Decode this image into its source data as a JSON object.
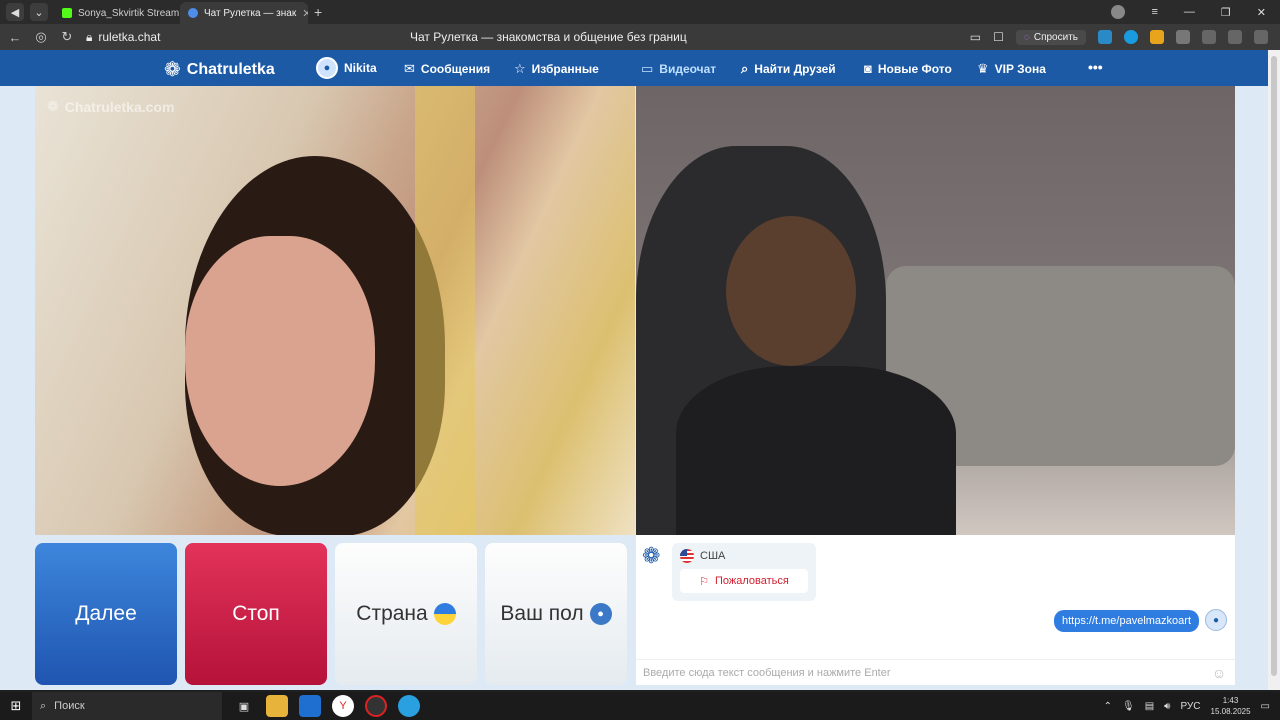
{
  "browser": {
    "tabs": [
      {
        "label": "Sonya_Skvirtik Stream - Ki"
      },
      {
        "label": "Чат Рулетка — знак"
      }
    ],
    "url": "ruletka.chat",
    "page_title": "Чат Рулетка — знакомства и общение без границ",
    "ask_label": "Спросить"
  },
  "site": {
    "logo": "Chatruletka",
    "nav": [
      {
        "label": "Nikita"
      },
      {
        "label": "Сообщения"
      },
      {
        "label": "Избранные"
      },
      {
        "label": "Видеочат"
      },
      {
        "label": "Найти Друзей"
      },
      {
        "label": "Новые Фото"
      },
      {
        "label": "VIP Зона"
      }
    ],
    "more": "•••"
  },
  "video": {
    "watermark": "Chatruletka.com"
  },
  "controls": {
    "next": "Далее",
    "stop": "Стоп",
    "country": "Страна",
    "gender": "Ваш пол"
  },
  "chat": {
    "partner_country": "США",
    "report": "Пожаловаться",
    "message": "https://t.me/pavelmazkoart",
    "input_placeholder": "Введите сюда текст сообщения и нажмите Enter"
  },
  "taskbar": {
    "search": "Поиск",
    "lang": "РУС",
    "time": "1:43",
    "date": "15.08.2025"
  },
  "colors": {
    "header": "#1d5aa6",
    "next": "#2d6fcb",
    "stop": "#d01f48",
    "bubble": "#2f7de1"
  }
}
